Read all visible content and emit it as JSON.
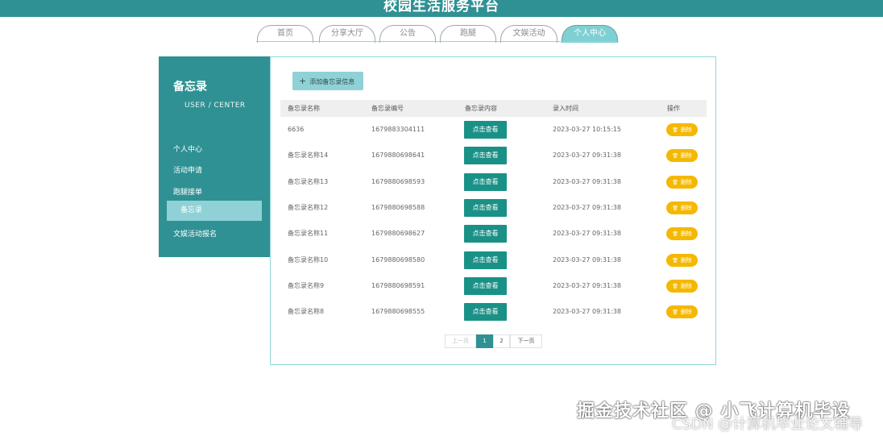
{
  "header": {
    "title": "校园生活服务平台"
  },
  "nav": {
    "tabs": [
      {
        "label": "首页",
        "active": false
      },
      {
        "label": "分享大厅",
        "active": false
      },
      {
        "label": "公告",
        "active": false
      },
      {
        "label": "跑腿",
        "active": false
      },
      {
        "label": "文娱活动",
        "active": false
      },
      {
        "label": "个人中心",
        "active": true
      }
    ]
  },
  "sidebar": {
    "title": "备忘录",
    "subtitle": "USER / CENTER",
    "items": [
      {
        "label": "个人中心",
        "active": false
      },
      {
        "label": "活动申请",
        "active": false
      },
      {
        "label": "跑腿接单",
        "active": false
      },
      {
        "label": "备忘录",
        "active": true
      },
      {
        "label": "文娱活动报名",
        "active": false
      }
    ]
  },
  "main": {
    "add_button": "添加备忘录信息",
    "add_icon": "+",
    "columns": [
      "备忘录名称",
      "备忘录编号",
      "备忘录内容",
      "录入时间",
      "操作"
    ],
    "view_label": "点击查看",
    "delete_label": "删除",
    "delete_icon": "trash-icon",
    "rows": [
      {
        "name": "6636",
        "number": "1679883304111",
        "time": "2023-03-27 10:15:15"
      },
      {
        "name": "备忘录名称14",
        "number": "1679880698641",
        "time": "2023-03-27 09:31:38"
      },
      {
        "name": "备忘录名称13",
        "number": "1679880698593",
        "time": "2023-03-27 09:31:38"
      },
      {
        "name": "备忘录名称12",
        "number": "1679880698588",
        "time": "2023-03-27 09:31:38"
      },
      {
        "name": "备忘录名称11",
        "number": "1679880698627",
        "time": "2023-03-27 09:31:38"
      },
      {
        "name": "备忘录名称10",
        "number": "1679880698580",
        "time": "2023-03-27 09:31:38"
      },
      {
        "name": "备忘录名称9",
        "number": "1679880698591",
        "time": "2023-03-27 09:31:38"
      },
      {
        "name": "备忘录名称8",
        "number": "1679880698555",
        "time": "2023-03-27 09:31:38"
      }
    ]
  },
  "pagination": {
    "prev": "上一页",
    "pages": [
      "1",
      "2"
    ],
    "current": "1",
    "next": "下一页"
  },
  "watermark": {
    "line1": "掘金技术社区 @ 小飞计算机毕设",
    "line2": "CSDN @计算机毕业论文辅导"
  },
  "colors": {
    "primary": "#2f9193",
    "accent": "#8fd1d6",
    "view_button": "#1a9186",
    "delete_button": "#f5b800"
  }
}
